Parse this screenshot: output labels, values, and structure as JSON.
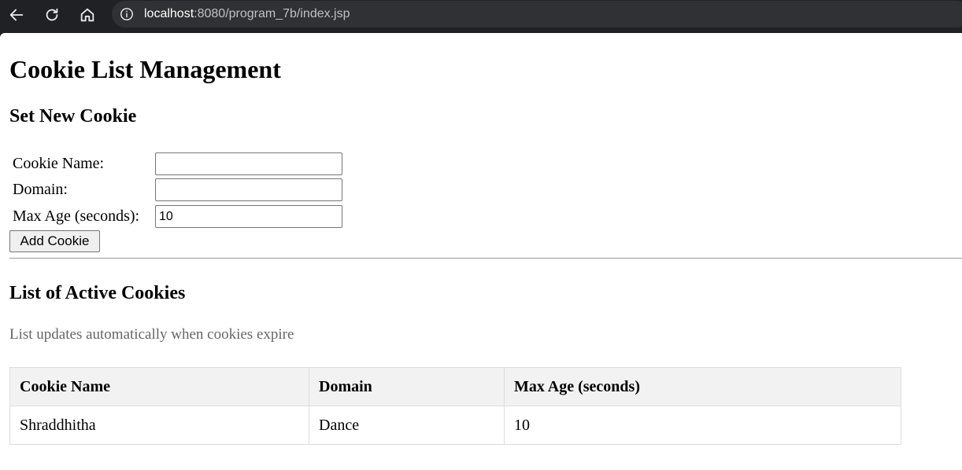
{
  "browser": {
    "url_host": "localhost",
    "url_rest": ":8080/program_7b/index.jsp",
    "icons": [
      "back-icon",
      "reload-icon",
      "home-icon",
      "site-info-icon"
    ]
  },
  "page": {
    "title": "Cookie List Management",
    "set_heading": "Set New Cookie",
    "form": {
      "name_label": "Cookie Name:",
      "name_value": "",
      "domain_label": "Domain:",
      "domain_value": "",
      "maxage_label": "Max Age (seconds):",
      "maxage_value": "10",
      "submit_label": "Add Cookie"
    },
    "list_heading": "List of Active Cookies",
    "note": "List updates automatically when cookies expire",
    "table": {
      "headers": [
        "Cookie Name",
        "Domain",
        "Max Age (seconds)"
      ],
      "rows": [
        [
          "Shraddhitha",
          "Dance",
          "10"
        ]
      ]
    }
  }
}
